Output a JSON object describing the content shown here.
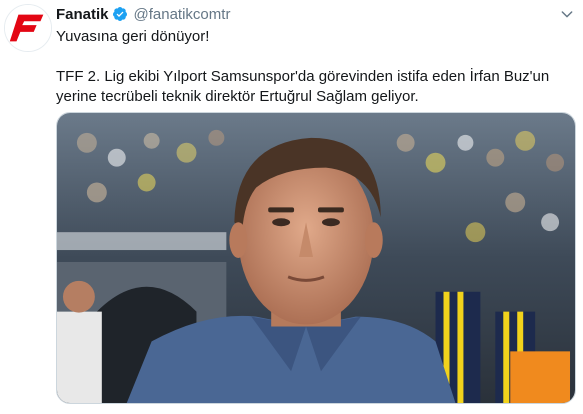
{
  "account": {
    "display_name": "Fanatik",
    "handle": "@fanatikcomtr",
    "verified": true,
    "avatar_icon": "fanatik-logo-icon",
    "brand_color": "#e30613"
  },
  "tweet": {
    "line1": "Yuvasına geri dönüyor!",
    "line2": "TFF 2. Lig ekibi Yılport Samsunspor'da görevinden istifa eden İrfan Buz'un yerine tecrübeli teknik direktör Ertuğrul Sağlam geliyor."
  },
  "media": {
    "icon": "photo-image-icon"
  },
  "colors": {
    "verified_blue": "#1da1f2",
    "handle_gray": "#657786",
    "text": "#14171a"
  }
}
